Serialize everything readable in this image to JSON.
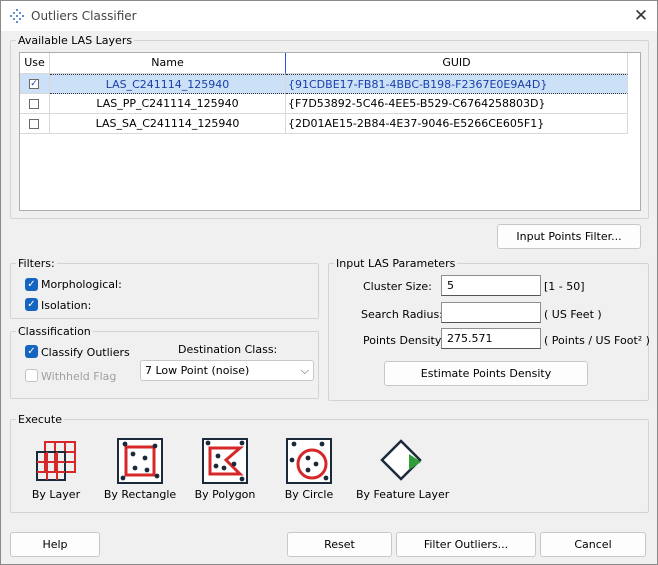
{
  "window": {
    "title": "Outliers Classifier",
    "close_glyph": "✕"
  },
  "layers": {
    "group_label": "Available LAS Layers",
    "columns": {
      "use": "Use",
      "name": "Name",
      "guid": "GUID"
    },
    "rows": [
      {
        "checked": true,
        "check_glyph": "✓",
        "name": "LAS_C241114_125940",
        "guid": "{91CDBE17-FB81-4BBC-B198-F2367E0E9A4D}"
      },
      {
        "checked": false,
        "check_glyph": "",
        "name": "LAS_PP_C241114_125940",
        "guid": "{F7D53892-5C46-4EE5-B529-C6764258803D}"
      },
      {
        "checked": false,
        "check_glyph": "",
        "name": "LAS_SA_C241114_125940",
        "guid": "{2D01AE15-2B84-4E37-9046-E5266CE605F1}"
      }
    ]
  },
  "input_points_filter_label": "Input Points Filter...",
  "filters": {
    "group_label": "Filters:",
    "morphological": {
      "label": "Morphological:",
      "checked": true
    },
    "isolation": {
      "label": "Isolation:",
      "checked": true
    }
  },
  "classification": {
    "group_label": "Classification",
    "classify_outliers": {
      "label": "Classify Outliers",
      "checked": true
    },
    "withheld_flag": {
      "label": "Withheld Flag",
      "checked": false,
      "disabled": true
    },
    "destination_class_label": "Destination Class:",
    "destination_class_value": "7  Low Point (noise)"
  },
  "input_params": {
    "group_label": "Input LAS Parameters",
    "cluster_size": {
      "label": "Cluster Size:",
      "value": "5",
      "hint": "[1 - 50]"
    },
    "search_radius": {
      "label": "Search Radius:",
      "value": "",
      "hint": "( US Feet )"
    },
    "points_density": {
      "label": "Points Density:",
      "value": "275.571",
      "hint": "( Points / US Foot² )"
    },
    "estimate_label": "Estimate Points Density"
  },
  "execute": {
    "group_label": "Execute",
    "tools": [
      {
        "label": "By Layer"
      },
      {
        "label": "By Rectangle"
      },
      {
        "label": "By Polygon"
      },
      {
        "label": "By Circle"
      },
      {
        "label": "By Feature Layer"
      }
    ]
  },
  "footer": {
    "help": "Help",
    "reset": "Reset",
    "filter_outliers": "Filter Outliers...",
    "cancel": "Cancel"
  },
  "colors": {
    "accent": "#1565c0",
    "selection": "#cce1f7",
    "icon_dark": "#1b2a3a",
    "icon_red": "#d62828",
    "icon_green": "#2e9d3a"
  }
}
